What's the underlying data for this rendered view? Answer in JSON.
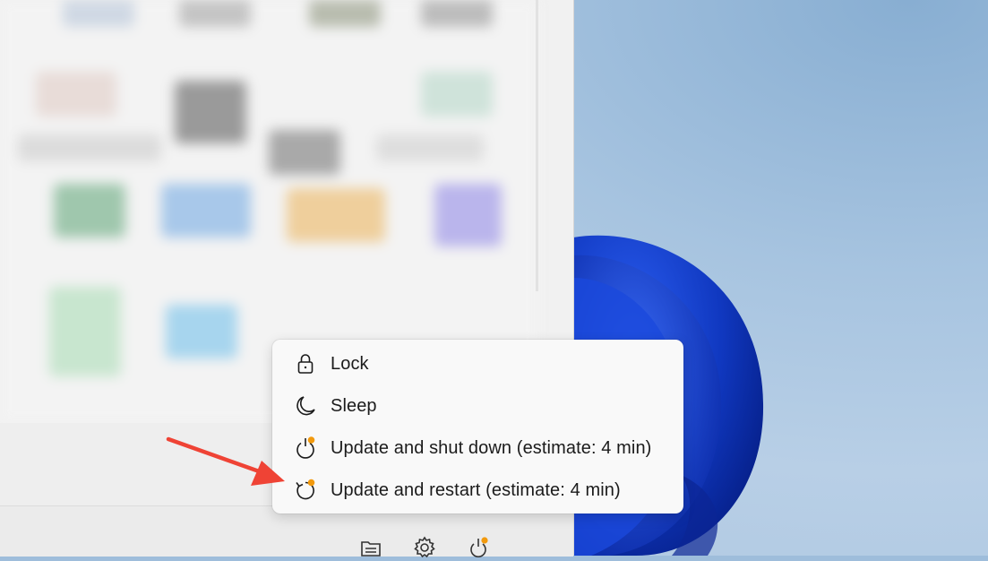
{
  "power_menu": {
    "items": [
      {
        "label": "Lock",
        "icon": "lock-icon"
      },
      {
        "label": "Sleep",
        "icon": "moon-icon"
      },
      {
        "label": "Update and shut down (estimate: 4 min)",
        "icon": "update-shutdown-icon"
      },
      {
        "label": "Update and restart (estimate: 4 min)",
        "icon": "update-restart-icon"
      }
    ]
  },
  "footer": {
    "buttons": [
      "file-explorer-icon",
      "settings-gear-icon",
      "power-update-icon"
    ]
  },
  "colors": {
    "update_badge": "#f29a0e",
    "annotation_arrow": "#ef4335",
    "menu_background": "#f9f9f9",
    "bloom_blue": "#1239c4"
  }
}
